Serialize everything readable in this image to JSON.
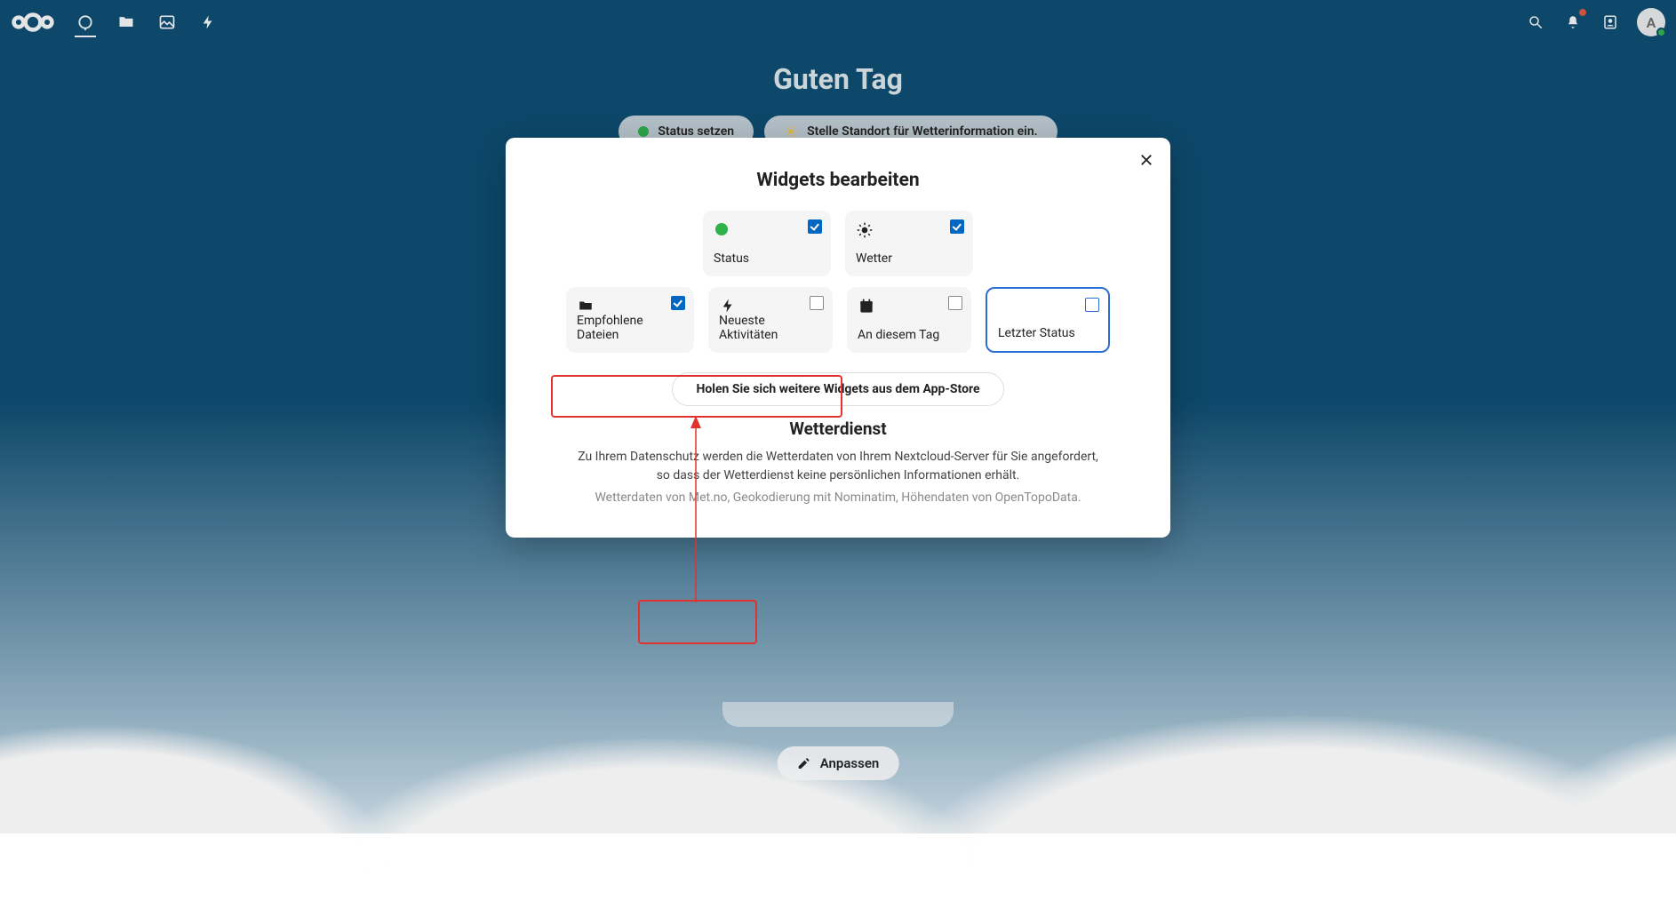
{
  "header": {
    "apps": [
      "dashboard",
      "files",
      "photos",
      "activity"
    ]
  },
  "avatar": {
    "initial": "A"
  },
  "dashboard": {
    "greeting": "Guten Tag",
    "status_pill": "Status setzen",
    "weather_pill": "Stelle Standort für Wetterinformation ein.",
    "customize": "Anpassen"
  },
  "modal": {
    "title": "Widgets bearbeiten",
    "widgets_row1": [
      {
        "key": "status",
        "label": "Status",
        "checked": true,
        "icon": "status-dot"
      },
      {
        "key": "weather",
        "label": "Wetter",
        "checked": true,
        "icon": "sun"
      }
    ],
    "widgets_row2": [
      {
        "key": "recommended",
        "label": "Empfohlene Dateien",
        "checked": true,
        "icon": "folder"
      },
      {
        "key": "recent-activity",
        "label": "Neueste Aktivitäten",
        "checked": false,
        "icon": "bolt"
      },
      {
        "key": "on-this-day",
        "label": "An diesem Tag",
        "checked": false,
        "icon": "calendar"
      },
      {
        "key": "last-status",
        "label": "Letzter Status",
        "checked": false,
        "icon": "moon",
        "focused": true
      }
    ],
    "appstore_link": "Holen Sie sich weitere Widgets aus dem App-Store",
    "weather_service_title": "Wetterdienst",
    "weather_service_desc1": "Zu Ihrem Datenschutz werden die Wetterdaten von Ihrem Nextcloud-Server für Sie angefordert,",
    "weather_service_desc2": "so dass der Wetterdienst keine persönlichen Informationen erhält.",
    "weather_service_credits": "Wetterdaten von Met.no, Geokodierung mit Nominatim, Höhendaten von OpenTopoData."
  }
}
